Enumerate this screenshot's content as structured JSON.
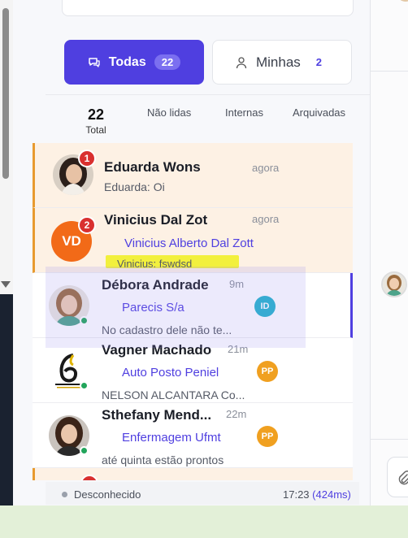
{
  "tabs": {
    "todas": {
      "label": "Todas",
      "count": "22"
    },
    "minhas": {
      "label": "Minhas",
      "count": "2"
    }
  },
  "subtabs": {
    "total_count": "22",
    "total_label": "Total",
    "nao_lidas": "Não lidas",
    "internas": "Internas",
    "arquivadas": "Arquivadas"
  },
  "conversations": [
    {
      "name": "Eduarda Wons",
      "time": "agora",
      "preview": "Eduarda: Oi",
      "unread": "1"
    },
    {
      "name": "Vinicius Dal Zot",
      "time": "agora",
      "initials": "VD",
      "contact": "Vinicius Alberto Dal Zott",
      "preview": "Vinicius: fswdsd",
      "unread": "2"
    },
    {
      "name": "Débora Andrade",
      "time": "9m",
      "contact": "Parecis S/a",
      "preview": "No cadastro dele não te...",
      "agent": "ID"
    },
    {
      "name": "Vagner Machado",
      "time": "21m",
      "contact": "Auto Posto Peniel",
      "preview": "NELSON ALCANTARA Co...",
      "agent": "PP"
    },
    {
      "name": "Sthefany Mend...",
      "time": "22m",
      "contact": "Enfermagem Ufmt",
      "preview": "até quinta estão prontos",
      "agent": "PP"
    }
  ],
  "footer": {
    "status": "Desconhecido",
    "time": "17:23",
    "latency": "(424ms)"
  },
  "colors": {
    "accent": "#4f3fe0",
    "unread_bg": "#fdf1e4",
    "unread_border": "#e89a2e",
    "badge_red": "#d9302f",
    "online": "#22a55b",
    "highlight": "#f1ef2a"
  }
}
